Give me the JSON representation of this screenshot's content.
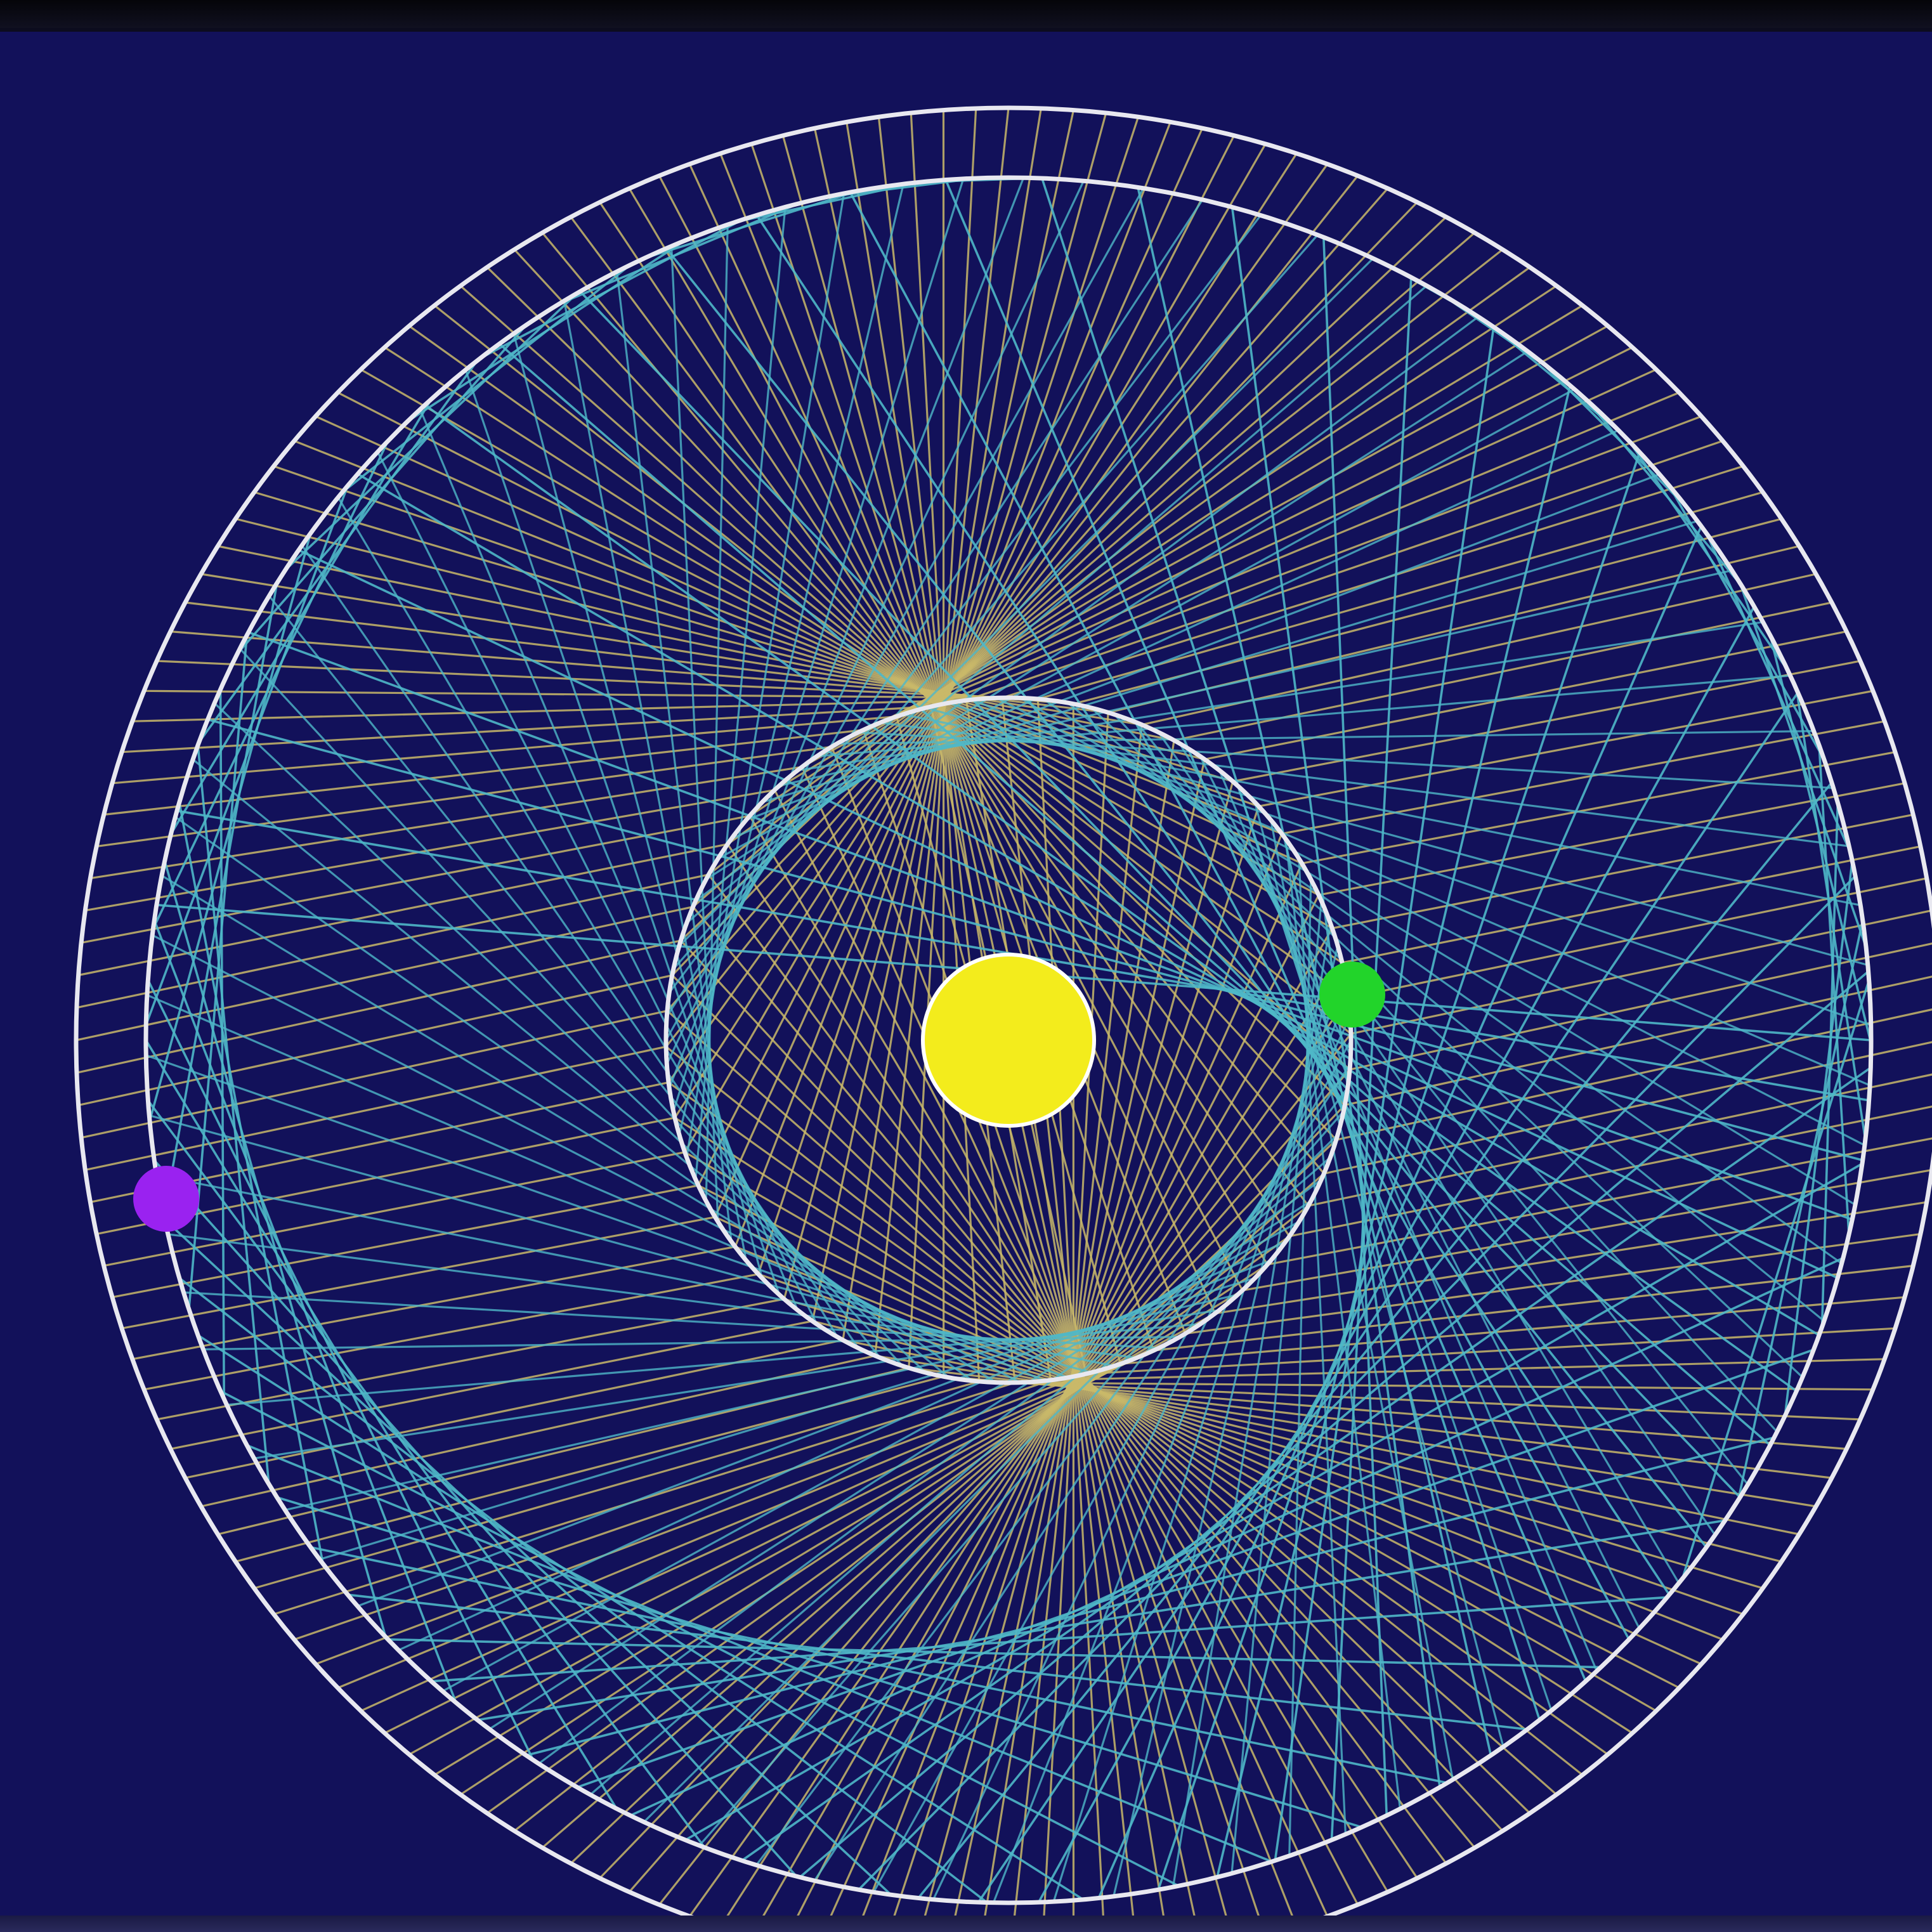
{
  "window": {
    "title": ""
  },
  "scene": {
    "background_color": "#12115a",
    "orbit_color": "#e8e8f0",
    "planets": [
      {
        "name": "sun",
        "color": "#f3ec1c"
      },
      {
        "name": "inner-planet",
        "color": "#22d42a"
      },
      {
        "name": "outer-planet",
        "color": "#9a22f0"
      }
    ],
    "line_sets": [
      {
        "color": "#c9b96a",
        "count": 180
      },
      {
        "color": "#4fb8c8",
        "count": 90
      }
    ]
  }
}
